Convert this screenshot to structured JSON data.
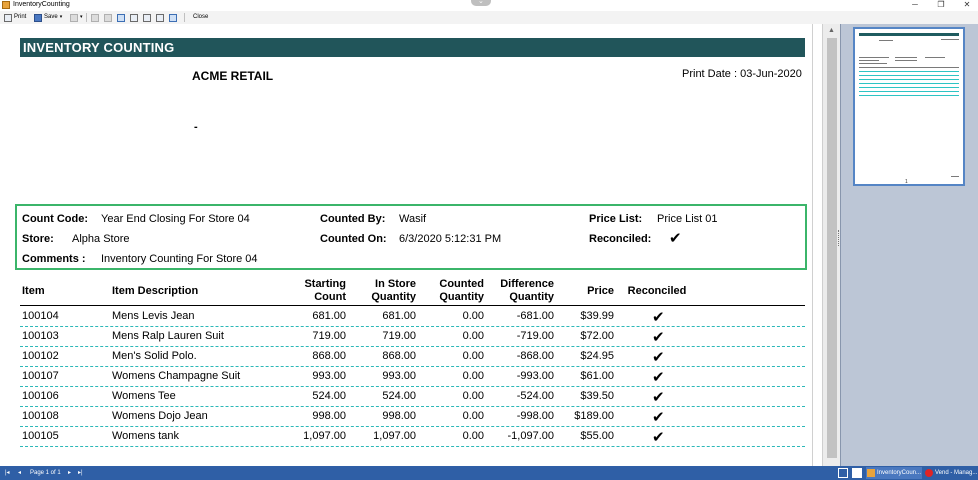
{
  "window": {
    "title": "InventoryCounting",
    "minimize": "─",
    "restore": "❐",
    "close": "✕",
    "center_glyph": "⌄"
  },
  "toolbar": {
    "print_label": "Print",
    "save_label": "Save",
    "close_label": "Close"
  },
  "report": {
    "header_title": "INVENTORY COUNTING",
    "company_name": "ACME RETAIL",
    "print_date": "Print Date : 03-Jun-2020",
    "dash": "-",
    "info": {
      "count_code_label": "Count Code:",
      "count_code_value": "Year End Closing For Store 04",
      "store_label": "Store:",
      "store_value": "Alpha Store",
      "comments_label": "Comments :",
      "comments_value": "Inventory Counting For Store 04",
      "counted_by_label": "Counted By:",
      "counted_by_value": "Wasif",
      "counted_on_label": "Counted On:",
      "counted_on_value": "6/3/2020 5:12:31 PM",
      "price_list_label": "Price List:",
      "price_list_value": "Price List 01",
      "reconciled_label": "Reconciled:",
      "reconciled_mark": "✔"
    },
    "columns": {
      "item": "Item",
      "description": "Item Description",
      "starting_count_1": "Starting",
      "starting_count_2": "Count",
      "in_store_1": "In Store",
      "in_store_2": "Quantity",
      "counted_1": "Counted",
      "counted_2": "Quantity",
      "difference_1": "Difference",
      "difference_2": "Quantity",
      "price": "Price",
      "reconciled": "Reconciled"
    },
    "rows": [
      {
        "item": "100104",
        "description": "Mens Levis Jean",
        "starting": "681.00",
        "in_store": "681.00",
        "counted": "0.00",
        "difference": "-681.00",
        "price": "$39.99",
        "reconciled": "✔"
      },
      {
        "item": "100103",
        "description": "Mens Ralp Lauren Suit",
        "starting": "719.00",
        "in_store": "719.00",
        "counted": "0.00",
        "difference": "-719.00",
        "price": "$72.00",
        "reconciled": "✔"
      },
      {
        "item": "100102",
        "description": "Men's Solid Polo.",
        "starting": "868.00",
        "in_store": "868.00",
        "counted": "0.00",
        "difference": "-868.00",
        "price": "$24.95",
        "reconciled": "✔"
      },
      {
        "item": "100107",
        "description": "Womens Champagne Suit",
        "starting": "993.00",
        "in_store": "993.00",
        "counted": "0.00",
        "difference": "-993.00",
        "price": "$61.00",
        "reconciled": "✔"
      },
      {
        "item": "100106",
        "description": "Womens Tee",
        "starting": "524.00",
        "in_store": "524.00",
        "counted": "0.00",
        "difference": "-524.00",
        "price": "$39.50",
        "reconciled": "✔"
      },
      {
        "item": "100108",
        "description": "Womens Dojo Jean",
        "starting": "998.00",
        "in_store": "998.00",
        "counted": "0.00",
        "difference": "-998.00",
        "price": "$189.00",
        "reconciled": "✔"
      },
      {
        "item": "100105",
        "description": "Womens tank",
        "starting": "1,097.00",
        "in_store": "1,097.00",
        "counted": "0.00",
        "difference": "-1,097.00",
        "price": "$55.00",
        "reconciled": "✔"
      }
    ]
  },
  "thumbnail": {
    "caption": "1"
  },
  "statusbar": {
    "first": "|◂",
    "prev": "◂",
    "page_info": "Page 1 of 1",
    "next": "▸",
    "last": "▸|",
    "task_1": "InventoryCoun...",
    "task_2": "Vend - Manag..."
  },
  "colors": {
    "header_bg": "#21555a",
    "info_border": "#3bb56a",
    "row_divider": "#2db8b8",
    "statusbar_bg": "#2f5fa6"
  }
}
